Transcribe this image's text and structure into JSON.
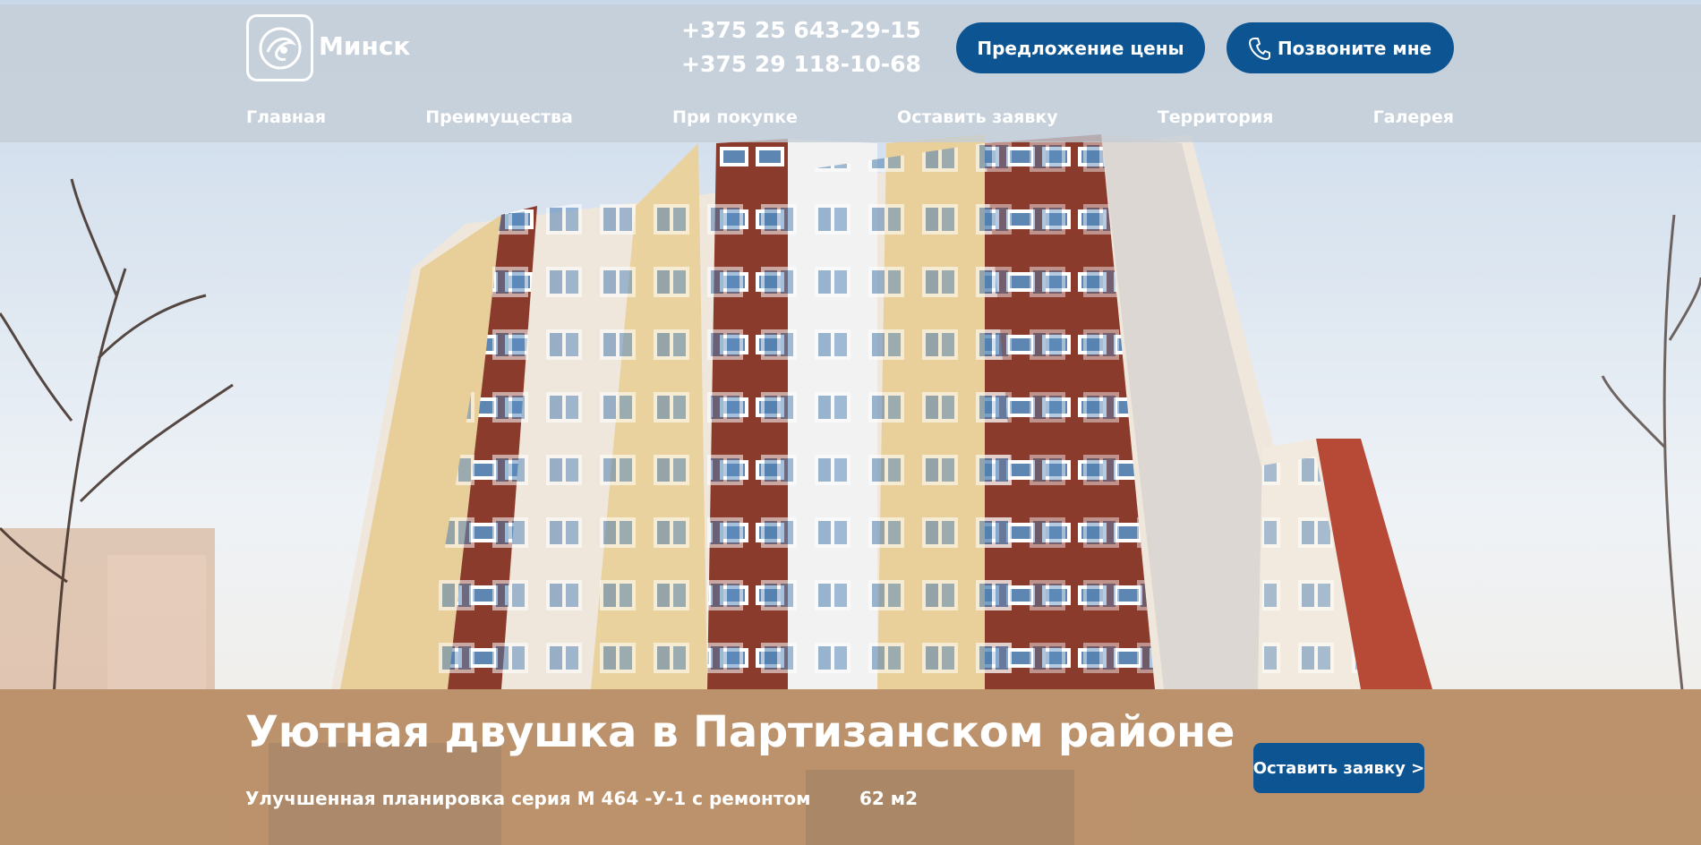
{
  "header": {
    "logo_text": "Минск",
    "phones": [
      "+375 25 643-29-15",
      "+375 29 118-10-68"
    ],
    "price_offer_button": "Предложение цены",
    "call_me_button": "Позвоните мне",
    "call_me_icon": "phone-icon",
    "logo_icon": "globe-logo-icon"
  },
  "nav": {
    "items": [
      "Главная",
      "Преимущества",
      "При покупке",
      "Оставить заявку",
      "Территория",
      "Галерея"
    ]
  },
  "hero": {
    "title": "Уютная двушка в Партизанском районе",
    "subtitle": "Улучшенная планировка серия М 464 -У-1 с ремонтом",
    "area": "62 м2",
    "request_button": "Оставить заявку >"
  },
  "colors": {
    "accent": "#0d5592",
    "header_overlay": "#c4cdd6",
    "caption_band": "#b08a64"
  }
}
